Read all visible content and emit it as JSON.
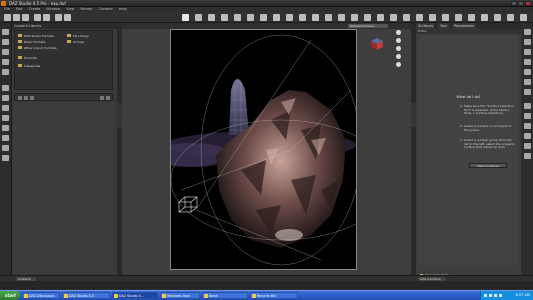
{
  "window": {
    "title": "DAZ Studio 4.5 Pro - exp.duf"
  },
  "menu": [
    "File",
    "Edit",
    "Create",
    "Window",
    "View",
    "Render",
    "Content",
    "Help"
  ],
  "left_panel": {
    "tab_label": "Content Library",
    "tree_left": [
      "DAZ Studio Formats",
      "Poser Formats",
      "Other Import Formats",
      "Products",
      "Categories"
    ],
    "tree_right": [
      "My Library",
      "Archive"
    ]
  },
  "viewport": {
    "camera": "Default Camera"
  },
  "right_panel": {
    "tabs": [
      "Surfaces",
      "Tool",
      "Parameters"
    ],
    "sub_label": "Editor",
    "heading": "What do I do?",
    "steps": [
      {
        "n": "1.",
        "text": "Make sure the \"Surface Selection Tool\" is selected. (from Menu> Tools > Surface Selection)"
      },
      {
        "n": "2.",
        "text": "Select a surface on an object in the scene."
      },
      {
        "n": "3.",
        "text": "Select a surface group from the list to the left; select the property surface that shows up here."
      }
    ],
    "button_label": "Make Surfaces",
    "checkbox_label": "Show Sub Items"
  },
  "bottom": {
    "left_selector": "Aniblock Clip",
    "right_selector": "Add a surface"
  },
  "taskbar": {
    "start_label": "start",
    "tasks": [
      "DAZ Discussion",
      "DAZ Studio 4.5",
      "DAZ Studio 4...",
      "Windows Task",
      "None",
      "Recycle Bin"
    ],
    "clock": "8:57 AM"
  },
  "colors": {
    "accent": "#d97a00",
    "taskbar": "#2a5cc8",
    "start": "#3b973b"
  }
}
